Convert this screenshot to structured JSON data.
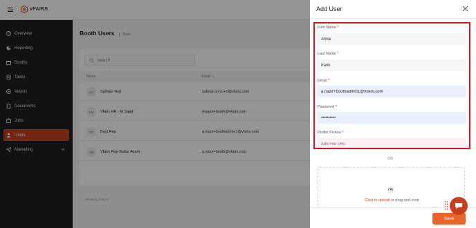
{
  "brand": {
    "logo_text": "vFAIRS",
    "accent": "#c6401f",
    "save_color": "#e8642b",
    "highlight": "#d8141e"
  },
  "sidebar": {
    "items": [
      {
        "label": "Overview",
        "icon": "gauge-icon"
      },
      {
        "label": "Reporting",
        "icon": "chart-icon"
      },
      {
        "label": "Booths",
        "icon": "store-icon"
      },
      {
        "label": "Tasks",
        "icon": "clipboard-icon"
      },
      {
        "label": "Videos",
        "icon": "video-icon"
      },
      {
        "label": "Documents",
        "icon": "document-icon"
      },
      {
        "label": "Jobs",
        "icon": "briefcase-icon"
      },
      {
        "label": "Users",
        "icon": "user-icon",
        "active": true
      },
      {
        "label": "Marketing",
        "icon": "paper-plane-icon",
        "expandable": true
      }
    ]
  },
  "page": {
    "title": "Booth Users",
    "breadcrumb": "Bayt"
  },
  "search": {
    "placeholder": "Search"
  },
  "table": {
    "headers": {
      "name": "Name",
      "email": "Email ↑↓"
    },
    "rows": [
      {
        "initials": "ST",
        "name": "Salman Test",
        "email": "salman.amin+1@vfairs.com"
      },
      {
        "initials": "VM",
        "name": "Vfairs HR - M Saad",
        "email": "msaad+booth@vfairs.com"
      },
      {
        "initials": "BR",
        "name": "Bayt Rep",
        "email": "a.nazir+boothadmin1@vfairs.com"
      },
      {
        "initials": "VB",
        "name": "Vfairs Rep Babar Azam",
        "email": "a.nazir+booth@vfairs.com"
      }
    ],
    "footer": "Showing 4 items"
  },
  "drawer": {
    "title": "Add User",
    "fields": {
      "first_name": {
        "label": "First Name",
        "value": "Anna"
      },
      "last_name": {
        "label": "Last Name",
        "value": "frank"
      },
      "email": {
        "label": "Email",
        "value": "a.nazir+boothadmin1@vfairs.com"
      },
      "password": {
        "label": "Password",
        "value": "••••••••••"
      },
      "profile_picture": {
        "label": "Profile Picture",
        "placeholder": "Add File URL"
      }
    },
    "required_mark": "*",
    "or_text": "OR",
    "upload": {
      "link": "Click to upload",
      "rest": " or drag and drop"
    },
    "save_label": "Save"
  }
}
